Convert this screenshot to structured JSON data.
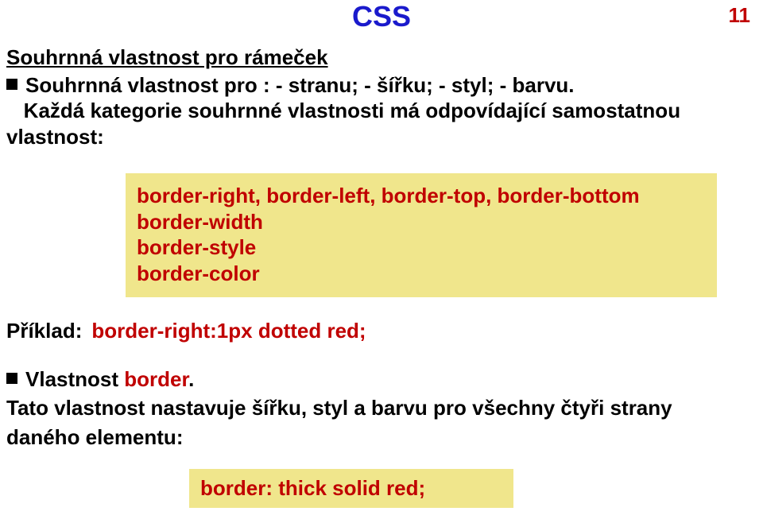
{
  "title": "CSS",
  "page_number": "11",
  "section_heading": "Souhrnná vlastnost pro rámeček",
  "bullet1": "Souhrnná vlastnost pro : - stranu; - šířku; - styl; - barvu.",
  "bullet1_cont1": "Každá kategorie souhrnné vlastnosti má odpovídající samostatnou",
  "bullet1_cont2": "vlastnost:",
  "codebox1": {
    "line1": "border-right, border-left, border-top, border-bottom",
    "line2": "border-width",
    "line3": "border-style",
    "line4": "border-color"
  },
  "example": {
    "label": "Příklad:",
    "code": "border-right:1px dotted red;"
  },
  "bullet2_prefix": "Vlastnost ",
  "bullet2_keyword": "border",
  "bullet2_suffix": ".",
  "bullet2_desc1": "Tato vlastnost nastavuje šířku, styl a barvu pro všechny čtyři strany",
  "bullet2_desc2": "daného elementu:",
  "codebox2": {
    "line1": "border: thick solid red;"
  }
}
